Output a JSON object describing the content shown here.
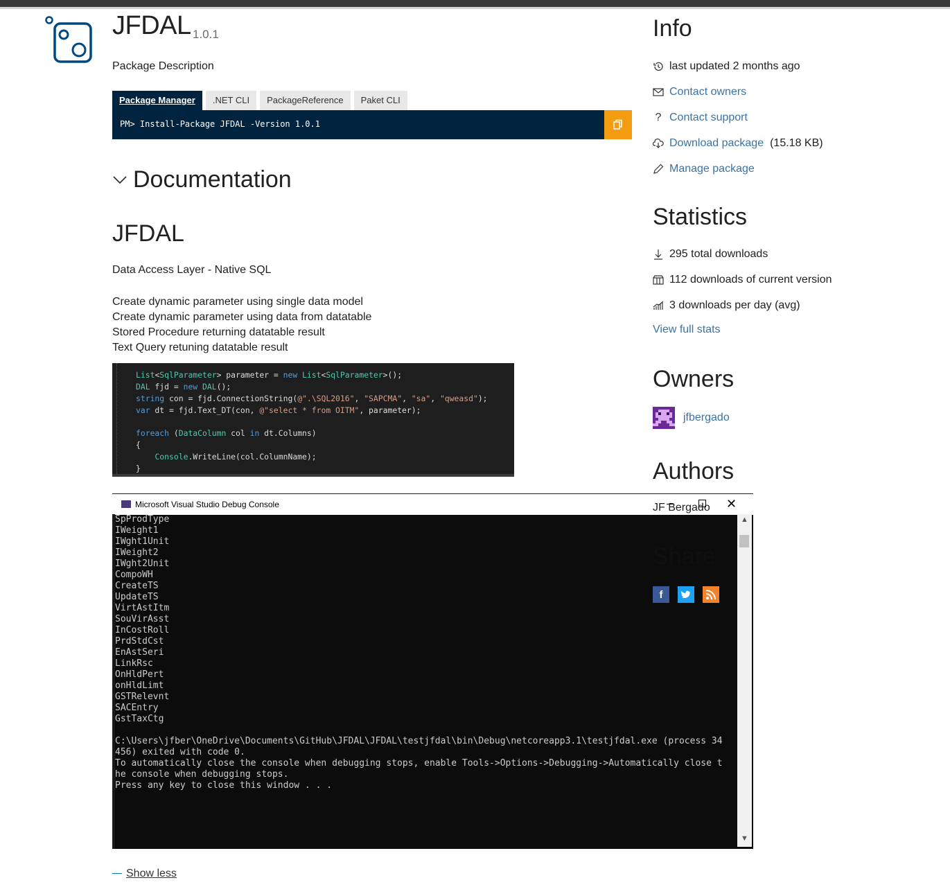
{
  "package": {
    "title": "JFDAL",
    "version": "1.0.1",
    "description": "Package Description"
  },
  "install": {
    "tabs": [
      "Package Manager",
      ".NET CLI",
      "PackageReference",
      "Paket CLI"
    ],
    "active_tab": "Package Manager",
    "command": "PM> Install-Package JFDAL -Version 1.0.1"
  },
  "documentation": {
    "heading": "Documentation",
    "readme_title": "JFDAL",
    "subtitle": "Data Access Layer - Native SQL",
    "features": [
      "Create dynamic parameter using single data model",
      "Create dynamic parameter using data from datatable",
      "Stored Procedure returning datatable result",
      "Text Query retuning datatable result"
    ],
    "code_lines": [
      "List<SqlParameter> parameter = new List<SqlParameter>();",
      "DAL fjd = new DAL();",
      "string con = fjd.ConnectionString(@\".\\SQL2016\", \"SAPCMA\", \"sa\", \"qweasd\");",
      "var dt = fjd.Text_DT(con, @\"select * from OITM\", parameter);",
      "foreach (DataColumn col in dt.Columns)",
      "{",
      "    Console.WriteLine(col.ColumnName);",
      "}"
    ],
    "console": {
      "title": "Microsoft Visual Studio Debug Console",
      "lines": [
        "SpProdType",
        "IWeight1",
        "IWght1Unit",
        "IWeight2",
        "IWght2Unit",
        "CompoWH",
        "CreateTS",
        "UpdateTS",
        "VirtAstItm",
        "SouVirAsst",
        "InCostRoll",
        "PrdStdCst",
        "EnAstSeri",
        "LinkRsc",
        "OnHldPert",
        "onHldLimt",
        "GSTRelevnt",
        "SACEntry",
        "GstTaxCtg",
        "",
        "C:\\Users\\jfber\\OneDrive\\Documents\\GitHub\\JFDAL\\JFDAL\\testjfdal\\bin\\Debug\\netcoreapp3.1\\testjfdal.exe (process 34",
        "456) exited with code 0.",
        "To automatically close the console when debugging stops, enable Tools->Options->Debugging->Automatically close t",
        "he console when debugging stops.",
        "Press any key to close this window . . ."
      ]
    },
    "show_less": "Show less"
  },
  "info": {
    "heading": "Info",
    "last_updated": "last updated 2 months ago",
    "contact_owners": "Contact owners",
    "contact_support": "Contact support",
    "download_package": "Download package",
    "download_size": "(15.18 KB)",
    "manage_package": "Manage package"
  },
  "statistics": {
    "heading": "Statistics",
    "total_downloads": "295 total downloads",
    "current_version_downloads": "112 downloads of current version",
    "per_day": "3 downloads per day (avg)",
    "view_full_stats": "View full stats"
  },
  "owners": {
    "heading": "Owners",
    "names": [
      "jfbergado"
    ]
  },
  "authors": {
    "heading": "Authors",
    "names": "JF Bergado"
  },
  "share": {
    "heading": "Share",
    "icons": [
      "facebook-icon",
      "twitter-icon",
      "rss-icon"
    ],
    "colors": {
      "facebook": "#3b5998",
      "twitter": "#1da1f2",
      "rss": "#f4822a"
    }
  },
  "colors": {
    "install_bg": "#002440",
    "copy_button": "#f39c12",
    "link": "#3973a6"
  }
}
